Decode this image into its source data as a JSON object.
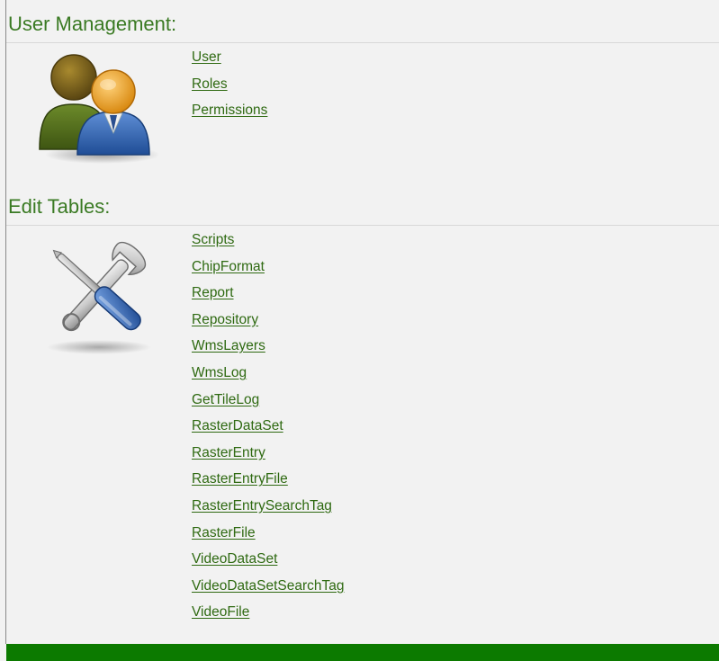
{
  "user_management": {
    "heading": "User Management:",
    "icon": "users-icon",
    "links": [
      "User",
      "Roles",
      "Permissions"
    ]
  },
  "edit_tables": {
    "heading": "Edit Tables:",
    "icon": "tools-icon",
    "links": [
      "Scripts",
      "ChipFormat",
      "Report",
      "Repository",
      "WmsLayers",
      "WmsLog",
      "GetTileLog",
      "RasterDataSet",
      "RasterEntry",
      "RasterEntryFile",
      "RasterEntrySearchTag",
      "RasterFile",
      "VideoDataSet",
      "VideoDataSetSearchTag",
      "VideoFile"
    ]
  },
  "colors": {
    "heading": "#3a7a23",
    "link": "#2f6a12",
    "footer": "#0c7a00",
    "background": "#f2f2f2"
  }
}
